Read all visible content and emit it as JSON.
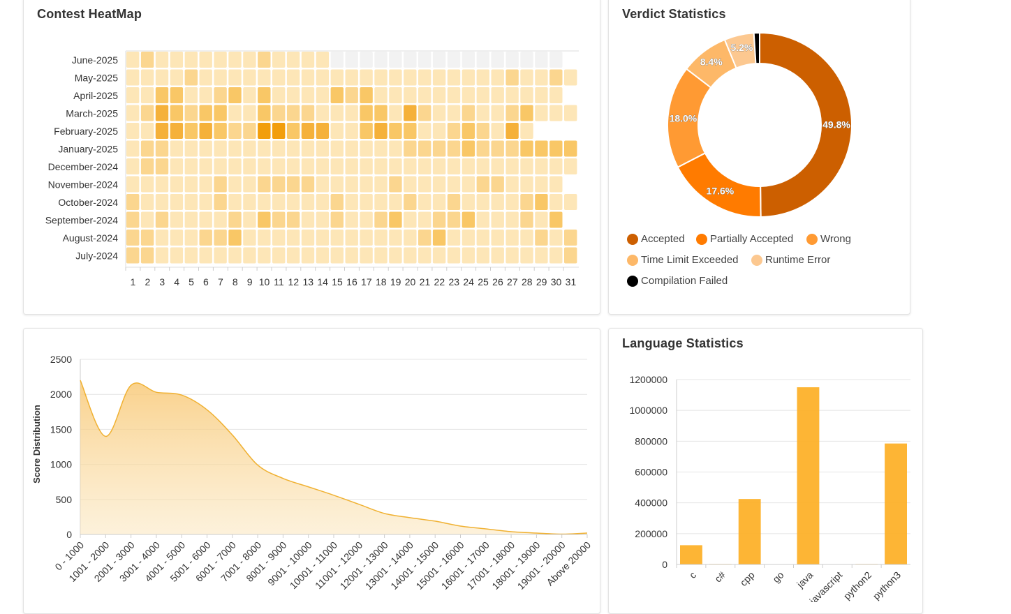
{
  "heatmap": {
    "title": "Contest HeatMap",
    "chart_data": {
      "type": "heatmap",
      "rows": [
        "June-2025",
        "May-2025",
        "April-2025",
        "March-2025",
        "February-2025",
        "January-2025",
        "December-2024",
        "November-2024",
        "October-2024",
        "September-2024",
        "August-2024",
        "July-2024"
      ],
      "columns": [
        "1",
        "2",
        "3",
        "4",
        "5",
        "6",
        "7",
        "8",
        "9",
        "10",
        "11",
        "12",
        "13",
        "14",
        "15",
        "16",
        "17",
        "18",
        "19",
        "20",
        "21",
        "22",
        "23",
        "24",
        "25",
        "26",
        "27",
        "28",
        "29",
        "30",
        "31"
      ],
      "levels": [
        [
          1,
          2,
          1,
          1,
          1,
          1,
          1,
          1,
          1,
          2,
          1,
          1,
          1,
          1,
          0,
          0,
          0,
          0,
          0,
          0,
          0,
          0,
          0,
          0,
          0,
          0,
          0,
          0,
          0,
          0,
          -1
        ],
        [
          1,
          1,
          1,
          1,
          2,
          1,
          1,
          1,
          1,
          1,
          1,
          1,
          1,
          1,
          1,
          1,
          1,
          1,
          1,
          1,
          1,
          1,
          1,
          1,
          1,
          1,
          2,
          1,
          1,
          2,
          1
        ],
        [
          1,
          1,
          3,
          3,
          1,
          1,
          2,
          3,
          1,
          3,
          1,
          1,
          1,
          1,
          3,
          2,
          3,
          1,
          1,
          1,
          1,
          1,
          1,
          1,
          1,
          1,
          1,
          1,
          1,
          1,
          -1
        ],
        [
          1,
          2,
          4,
          3,
          2,
          3,
          3,
          1,
          1,
          3,
          2,
          2,
          2,
          1,
          1,
          1,
          3,
          3,
          1,
          4,
          2,
          1,
          1,
          2,
          1,
          1,
          2,
          3,
          1,
          1,
          1
        ],
        [
          1,
          1,
          4,
          4,
          3,
          4,
          3,
          2,
          2,
          5,
          5,
          3,
          4,
          4,
          1,
          1,
          3,
          4,
          3,
          3,
          1,
          1,
          2,
          3,
          2,
          1,
          4,
          1,
          -1,
          -1,
          -1
        ],
        [
          1,
          2,
          2,
          1,
          1,
          1,
          1,
          1,
          1,
          1,
          1,
          1,
          1,
          1,
          1,
          1,
          1,
          1,
          1,
          2,
          2,
          2,
          2,
          3,
          2,
          2,
          2,
          3,
          3,
          3,
          3
        ],
        [
          1,
          2,
          2,
          1,
          1,
          1,
          1,
          1,
          1,
          1,
          1,
          1,
          1,
          1,
          1,
          1,
          1,
          1,
          1,
          1,
          1,
          1,
          1,
          1,
          1,
          1,
          1,
          1,
          1,
          1,
          1
        ],
        [
          1,
          1,
          1,
          1,
          1,
          1,
          2,
          1,
          1,
          2,
          2,
          2,
          2,
          1,
          1,
          1,
          1,
          1,
          2,
          1,
          1,
          1,
          1,
          1,
          2,
          2,
          1,
          1,
          1,
          1,
          -1
        ],
        [
          2,
          1,
          1,
          1,
          1,
          1,
          2,
          1,
          1,
          1,
          1,
          1,
          1,
          1,
          2,
          1,
          1,
          1,
          1,
          2,
          1,
          1,
          2,
          1,
          1,
          1,
          1,
          2,
          3,
          1,
          1
        ],
        [
          2,
          1,
          2,
          1,
          1,
          1,
          1,
          2,
          1,
          3,
          2,
          2,
          1,
          1,
          2,
          1,
          1,
          2,
          3,
          1,
          1,
          2,
          2,
          3,
          1,
          1,
          1,
          2,
          1,
          3,
          -1
        ],
        [
          2,
          2,
          1,
          1,
          1,
          2,
          2,
          3,
          1,
          1,
          1,
          1,
          1,
          1,
          1,
          1,
          1,
          1,
          1,
          1,
          2,
          3,
          1,
          1,
          1,
          1,
          1,
          1,
          2,
          1,
          2
        ],
        [
          2,
          2,
          1,
          1,
          1,
          1,
          1,
          1,
          1,
          1,
          1,
          1,
          1,
          1,
          1,
          1,
          1,
          1,
          1,
          1,
          1,
          1,
          1,
          1,
          1,
          1,
          1,
          1,
          1,
          1,
          2
        ]
      ],
      "level_colors": [
        "#f2f2f2",
        "#fde6b7",
        "#fbd68f",
        "#f9c766",
        "#f5b13a",
        "#f29e0c"
      ]
    }
  },
  "verdict": {
    "title": "Verdict Statistics",
    "chart_data": {
      "type": "pie",
      "labels": [
        "Accepted",
        "Partially Accepted",
        "Wrong",
        "Time Limit Exceeded",
        "Runtime Error",
        "Compilation Failed"
      ],
      "values": [
        49.8,
        17.6,
        18.0,
        8.4,
        5.2,
        1.0
      ],
      "value_labels": [
        "49.8%",
        "17.6%",
        "18.0%",
        "8.4%",
        "5.2%",
        ""
      ],
      "colors": [
        "#cc5f00",
        "#ff7b00",
        "#ff9a33",
        "#fdb868",
        "#fcc890",
        "#000000"
      ]
    }
  },
  "score": {
    "chart_data": {
      "type": "area",
      "ylabel": "Score Distribution",
      "categories": [
        "0 - 1000",
        "1001 - 2000",
        "2001 - 3000",
        "3001 - 4000",
        "4001 - 5000",
        "5001 - 6000",
        "6001 - 7000",
        "7001 - 8000",
        "8001 - 9000",
        "9001 - 10000",
        "10001 - 11000",
        "11001 - 12000",
        "12001 - 13000",
        "13001 - 14000",
        "14001 - 15000",
        "15001 - 16000",
        "16001 - 17000",
        "17001 - 18000",
        "18001 - 19000",
        "19001 - 20000",
        "Above 20000"
      ],
      "values": [
        2200,
        1400,
        2130,
        2030,
        1990,
        1780,
        1420,
        990,
        800,
        680,
        560,
        430,
        300,
        240,
        190,
        120,
        80,
        40,
        20,
        5,
        20
      ],
      "yticks": [
        "0",
        "500",
        "1000",
        "1500",
        "2000",
        "2500"
      ],
      "ylim": [
        0,
        2500
      ],
      "color": "#f0b132"
    }
  },
  "language": {
    "title": "Language Statistics",
    "chart_data": {
      "type": "bar",
      "categories": [
        "c",
        "c#",
        "cpp",
        "go",
        "java",
        "javascript",
        "python2",
        "python3"
      ],
      "values": [
        125000,
        3000,
        425000,
        1000,
        1150000,
        2000,
        3000,
        785000
      ],
      "yticks": [
        "0",
        "200000",
        "400000",
        "600000",
        "800000",
        "1000000",
        "1200000"
      ],
      "ylim": [
        0,
        1200000
      ],
      "color": "#fdb12a"
    }
  }
}
